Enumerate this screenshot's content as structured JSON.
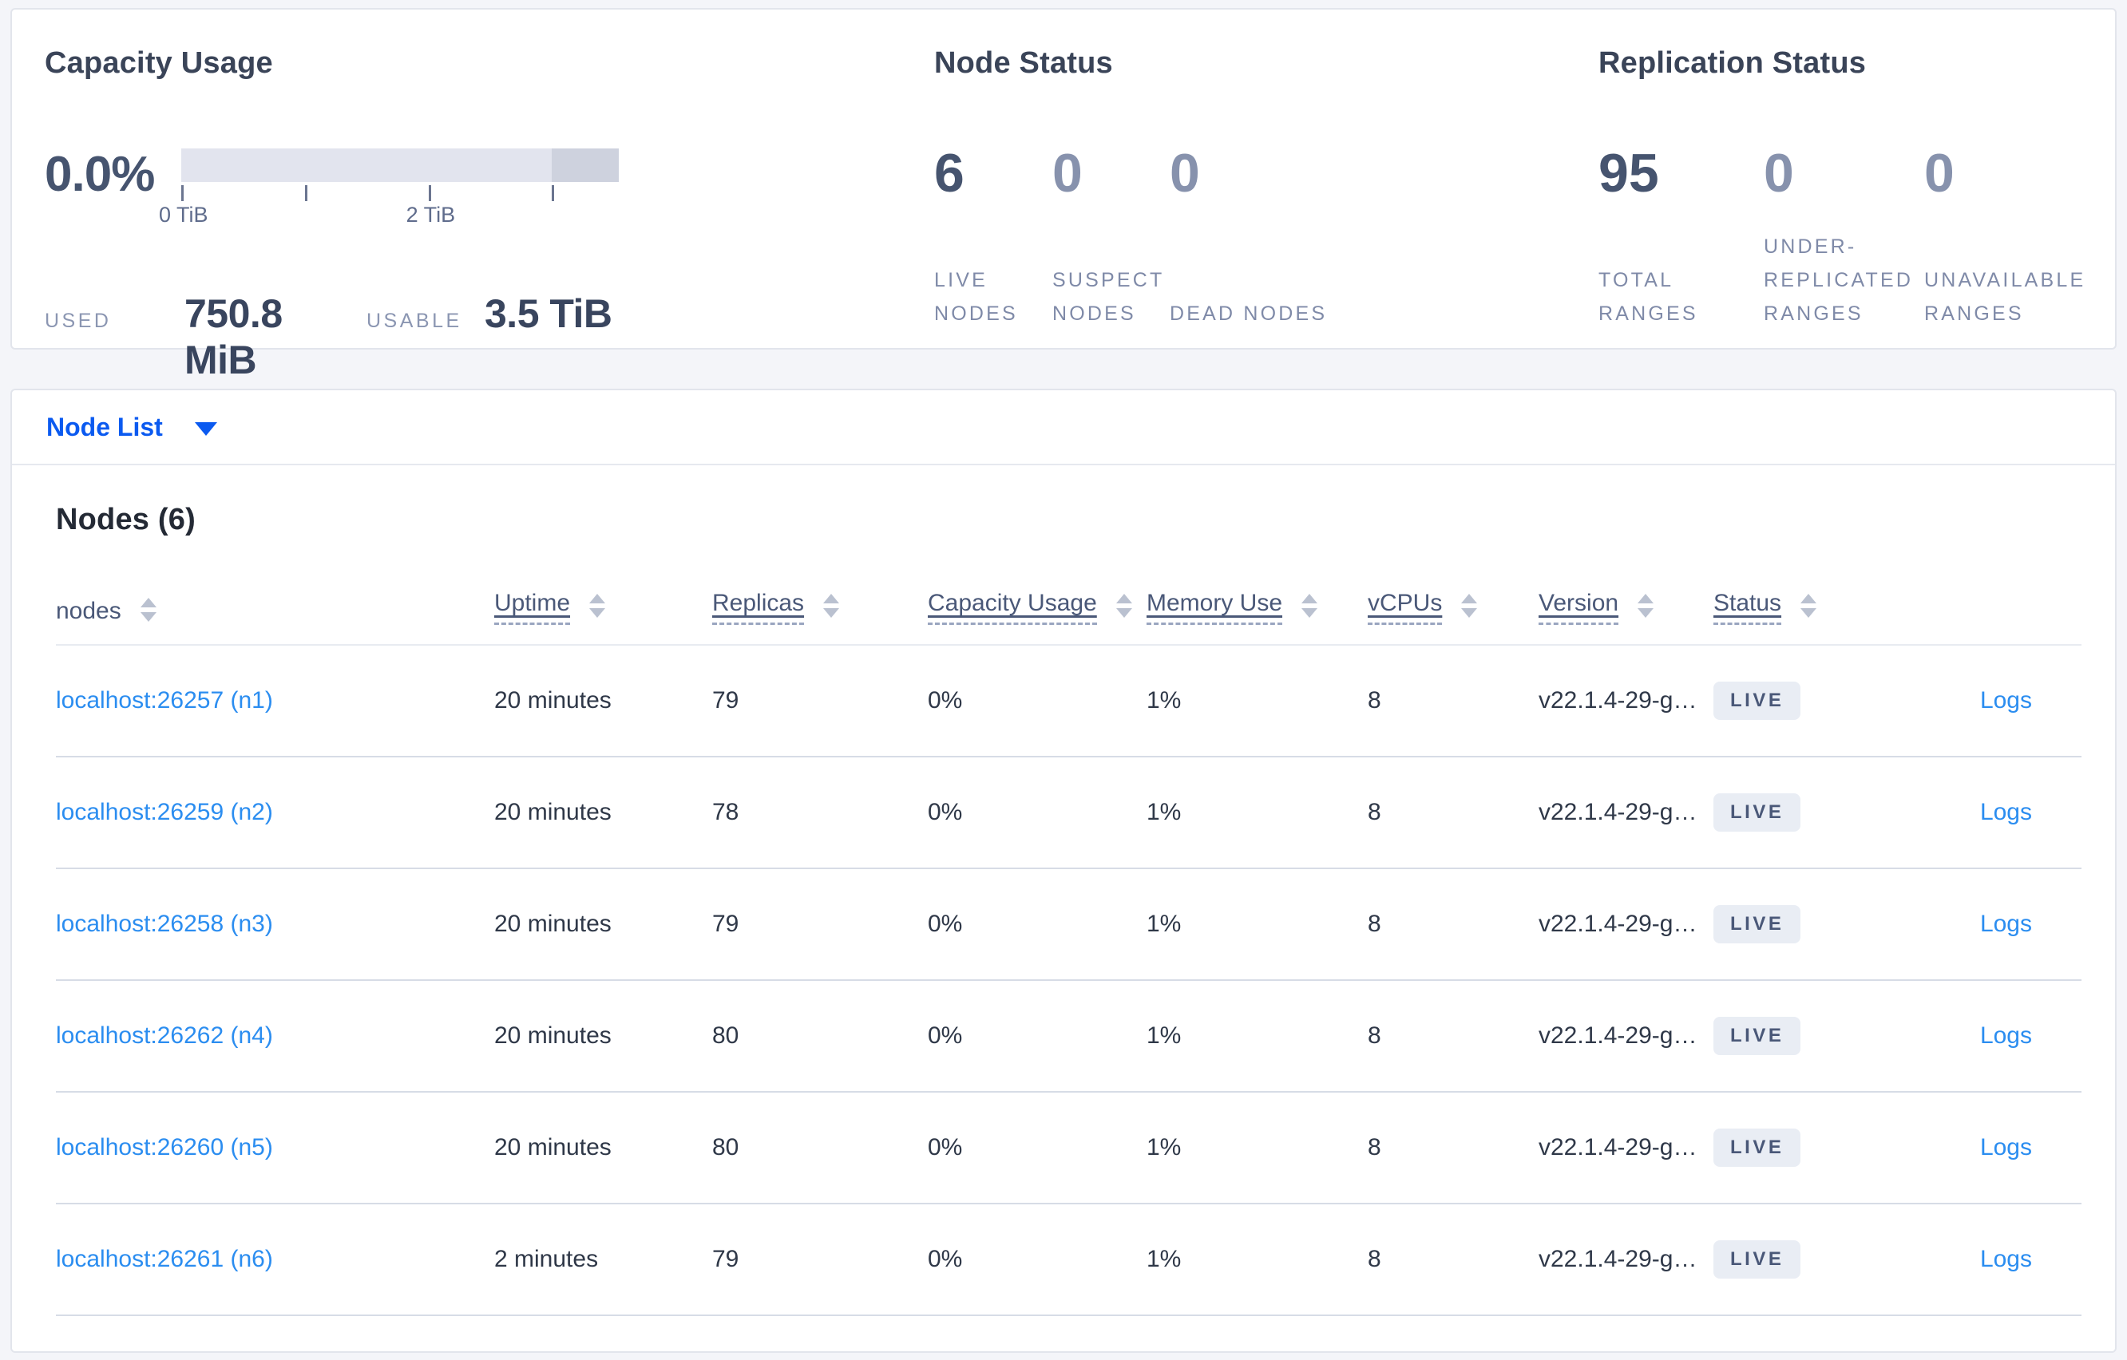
{
  "summary": {
    "capacity": {
      "title": "Capacity Usage",
      "percent": "0.0%",
      "axis_tick_labels": [
        "0 TiB",
        "2 TiB"
      ],
      "bar": {
        "extra_segment_start_pct": 84.7
      },
      "used_label": "USED",
      "used_value": "750.8 MiB",
      "usable_label": "USABLE",
      "usable_value": "3.5 TiB"
    },
    "node_status": {
      "title": "Node Status",
      "stats": [
        {
          "value": "6",
          "label": "LIVE NODES",
          "emphasis": "strong"
        },
        {
          "value": "0",
          "label": "SUSPECT NODES",
          "emphasis": "muted"
        },
        {
          "value": "0",
          "label": "DEAD NODES",
          "emphasis": "muted"
        }
      ]
    },
    "replication": {
      "title": "Replication Status",
      "stats": [
        {
          "value": "95",
          "label": "TOTAL RANGES",
          "emphasis": "strong"
        },
        {
          "value": "0",
          "label": "UNDER-REPLICATED RANGES",
          "emphasis": "muted"
        },
        {
          "value": "0",
          "label": "UNAVAILABLE RANGES",
          "emphasis": "muted"
        }
      ]
    }
  },
  "node_list": {
    "dropdown_label": "Node List"
  },
  "nodes_table": {
    "heading": "Nodes (6)",
    "columns": [
      {
        "key": "nodes",
        "label": "nodes",
        "underline": false,
        "sortable": true
      },
      {
        "key": "uptime",
        "label": "Uptime",
        "underline": true,
        "sortable": true
      },
      {
        "key": "replicas",
        "label": "Replicas",
        "underline": true,
        "sortable": true
      },
      {
        "key": "capacity_usage",
        "label": "Capacity Usage",
        "underline": true,
        "sortable": true
      },
      {
        "key": "memory_use",
        "label": "Memory Use",
        "underline": true,
        "sortable": true
      },
      {
        "key": "vcpus",
        "label": "vCPUs",
        "underline": true,
        "sortable": true
      },
      {
        "key": "version",
        "label": "Version",
        "underline": true,
        "sortable": true
      },
      {
        "key": "status",
        "label": "Status",
        "underline": true,
        "sortable": true
      },
      {
        "key": "logs",
        "label": "",
        "underline": false,
        "sortable": false
      }
    ],
    "rows": [
      {
        "nodes": "localhost:26257 (n1)",
        "uptime": "20 minutes",
        "replicas": "79",
        "capacity_usage": "0%",
        "memory_use": "1%",
        "vcpus": "8",
        "version": "v22.1.4-29-g…",
        "status": "LIVE",
        "logs": "Logs"
      },
      {
        "nodes": "localhost:26259 (n2)",
        "uptime": "20 minutes",
        "replicas": "78",
        "capacity_usage": "0%",
        "memory_use": "1%",
        "vcpus": "8",
        "version": "v22.1.4-29-g…",
        "status": "LIVE",
        "logs": "Logs"
      },
      {
        "nodes": "localhost:26258 (n3)",
        "uptime": "20 minutes",
        "replicas": "79",
        "capacity_usage": "0%",
        "memory_use": "1%",
        "vcpus": "8",
        "version": "v22.1.4-29-g…",
        "status": "LIVE",
        "logs": "Logs"
      },
      {
        "nodes": "localhost:26262 (n4)",
        "uptime": "20 minutes",
        "replicas": "80",
        "capacity_usage": "0%",
        "memory_use": "1%",
        "vcpus": "8",
        "version": "v22.1.4-29-g…",
        "status": "LIVE",
        "logs": "Logs"
      },
      {
        "nodes": "localhost:26260 (n5)",
        "uptime": "20 minutes",
        "replicas": "80",
        "capacity_usage": "0%",
        "memory_use": "1%",
        "vcpus": "8",
        "version": "v22.1.4-29-g…",
        "status": "LIVE",
        "logs": "Logs"
      },
      {
        "nodes": "localhost:26261 (n6)",
        "uptime": "2 minutes",
        "replicas": "79",
        "capacity_usage": "0%",
        "memory_use": "1%",
        "vcpus": "8",
        "version": "v22.1.4-29-g…",
        "status": "LIVE",
        "logs": "Logs"
      }
    ]
  },
  "colors": {
    "page_background": "#f4f5f9",
    "panel_border": "#e2e5ec",
    "heading_dark": "#3a4458",
    "stat_strong": "#46546f",
    "stat_muted": "#8792ad",
    "label_muted": "#7f8aa8",
    "primary_blue": "#0b5af0",
    "link_blue": "#2b8df0",
    "bar_light": "#e2e4ee",
    "bar_dark": "#ced2de",
    "badge_bg": "#e9edf4",
    "row_border": "#d7dce6"
  }
}
